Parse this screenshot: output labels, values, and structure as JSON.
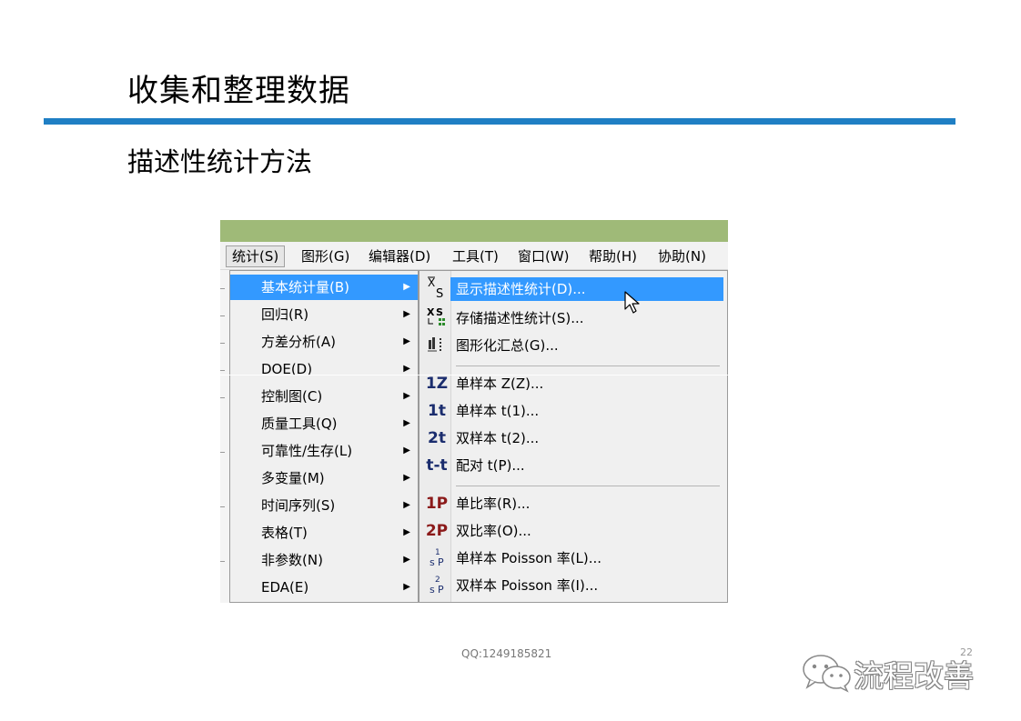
{
  "slide": {
    "title": "收集和整理数据",
    "subtitle": "描述性统计方法",
    "footer_qq": "QQ:1249185821",
    "page_number": "22",
    "brand": "流程改善",
    "accent_color": "#1f7fc4"
  },
  "screenshot": {
    "titlebar_color": "#9fba78",
    "highlight_color": "#3399ff",
    "menubar": {
      "items": [
        {
          "label": "统计(S)"
        },
        {
          "label": "图形(G)"
        },
        {
          "label": "编辑器(D)"
        },
        {
          "label": "工具(T)"
        },
        {
          "label": "窗口(W)"
        },
        {
          "label": "帮助(H)"
        },
        {
          "label": "协助(N)"
        }
      ]
    },
    "stat_menu": {
      "items": [
        {
          "label": "基本统计量(B)"
        },
        {
          "label": "回归(R)"
        },
        {
          "label": "方差分析(A)"
        },
        {
          "label": "DOE(D)"
        },
        {
          "label": "控制图(C)"
        },
        {
          "label": "质量工具(Q)"
        },
        {
          "label": "可靠性/生存(L)"
        },
        {
          "label": "多变量(M)"
        },
        {
          "label": "时间序列(S)"
        },
        {
          "label": "表格(T)"
        },
        {
          "label": "非参数(N)"
        },
        {
          "label": "EDA(E)"
        }
      ]
    },
    "basic_stats_menu": {
      "items": [
        {
          "icon": "display-descriptive-stats-icon",
          "icon_text": "X̄S",
          "label": "显示描述性统计(D)..."
        },
        {
          "icon": "store-descriptive-stats-icon",
          "icon_text": "X̄S",
          "label": "存储描述性统计(S)..."
        },
        {
          "icon": "graphical-summary-icon",
          "icon_text": "",
          "label": "图形化汇总(G)..."
        },
        {
          "icon": "one-sample-z-icon",
          "icon_text": "1Z",
          "label": "单样本 Z(Z)..."
        },
        {
          "icon": "one-sample-t-icon",
          "icon_text": "1t",
          "label": "单样本 t(1)..."
        },
        {
          "icon": "two-sample-t-icon",
          "icon_text": "2t",
          "label": "双样本 t(2)..."
        },
        {
          "icon": "paired-t-icon",
          "icon_text": "t-t",
          "label": "配对 t(P)..."
        },
        {
          "icon": "one-proportion-icon",
          "icon_text": "1P",
          "label": "单比率(R)..."
        },
        {
          "icon": "two-proportions-icon",
          "icon_text": "2P",
          "label": "双比率(O)..."
        },
        {
          "icon": "one-sample-poisson-icon",
          "icon_text": "1",
          "label": "单样本 Poisson 率(L)..."
        },
        {
          "icon": "two-sample-poisson-icon",
          "icon_text": "2",
          "label": "双样本 Poisson 率(I)..."
        }
      ]
    }
  }
}
